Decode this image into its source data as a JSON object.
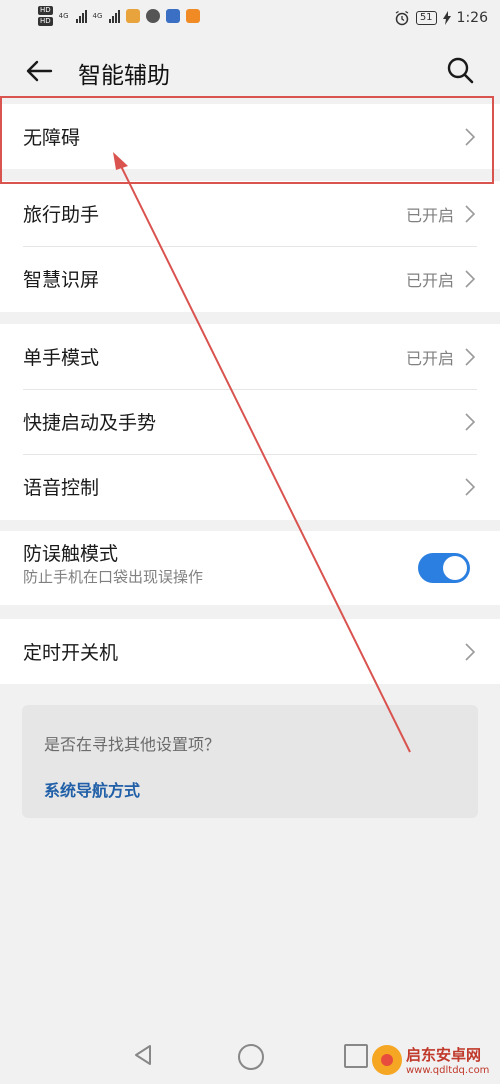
{
  "status_bar": {
    "hd1": "HD",
    "hd2": "HD",
    "net1": "4G",
    "net2": "4G",
    "battery": "51",
    "time": "1:26"
  },
  "header": {
    "title": "智能辅助"
  },
  "groups": {
    "accessibility": {
      "label": "无障碍"
    },
    "travel_assistant": {
      "label": "旅行助手",
      "status": "已开启"
    },
    "smart_screen": {
      "label": "智慧识屏",
      "status": "已开启"
    },
    "one_hand": {
      "label": "单手模式",
      "status": "已开启"
    },
    "shortcuts": {
      "label": "快捷启动及手势"
    },
    "voice_control": {
      "label": "语音控制"
    },
    "pocket_mode": {
      "label": "防误触模式",
      "subtitle": "防止手机在口袋出现误操作",
      "enabled": true
    },
    "scheduled_power": {
      "label": "定时开关机"
    }
  },
  "suggestion": {
    "question": "是否在寻找其他设置项？",
    "link": "系统导航方式"
  },
  "watermark": {
    "line1": "启东安卓网",
    "line2": "www.qdltdq.com"
  },
  "colors": {
    "toggle_on": "#2b7fe0",
    "link": "#2160a8",
    "annotation": "#d9534f"
  }
}
